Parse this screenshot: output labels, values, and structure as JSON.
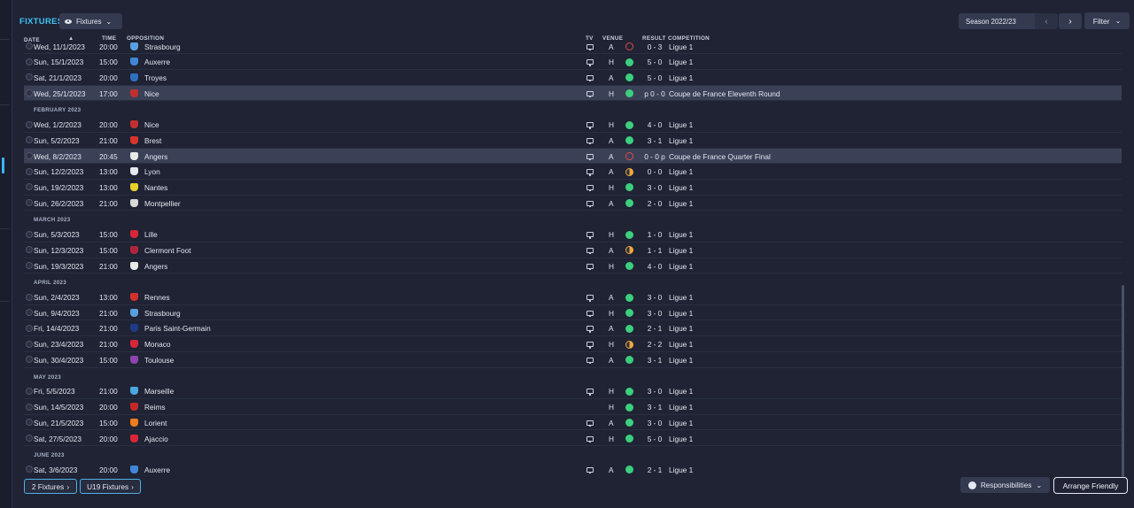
{
  "header": {
    "title": "FIXTURES",
    "view_dropdown": "Fixtures",
    "season": "Season 2022/23",
    "filter": "Filter"
  },
  "columns": {
    "date": "DATE",
    "time": "TIME",
    "opposition": "OPPOSITION",
    "tv": "TV",
    "venue": "VENUE",
    "result": "RESULT",
    "competition": "COMPETITION"
  },
  "rows": [
    {
      "kind": "match",
      "date": "Wed, 11/1/2023",
      "time": "20:00",
      "opp": "Strasbourg",
      "crest": "#5aa0e0",
      "tv": true,
      "venue": "A",
      "res": "L",
      "score": "0 - 3",
      "comp": "Ligue 1"
    },
    {
      "kind": "match",
      "date": "Sun, 15/1/2023",
      "time": "15:00",
      "opp": "Auxerre",
      "crest": "#3f86d8",
      "tv": true,
      "venue": "H",
      "res": "W",
      "score": "5 - 0",
      "comp": "Ligue 1"
    },
    {
      "kind": "match",
      "date": "Sat, 21/1/2023",
      "time": "20:00",
      "opp": "Troyes",
      "crest": "#2f6fc0",
      "tv": true,
      "venue": "A",
      "res": "W",
      "score": "5 - 0",
      "comp": "Ligue 1"
    },
    {
      "kind": "match",
      "date": "Wed, 25/1/2023",
      "time": "17:00",
      "opp": "Nice",
      "crest": "#c0302f",
      "tv": true,
      "venue": "H",
      "res": "W",
      "score": "p 0 - 0",
      "comp": "Coupe de France Eleventh Round",
      "hl": true
    },
    {
      "kind": "month",
      "label": "FEBRUARY 2023"
    },
    {
      "kind": "match",
      "date": "Wed, 1/2/2023",
      "time": "20:00",
      "opp": "Nice",
      "crest": "#c0302f",
      "tv": true,
      "venue": "H",
      "res": "W",
      "score": "4 - 0",
      "comp": "Ligue 1"
    },
    {
      "kind": "match",
      "date": "Sun, 5/2/2023",
      "time": "21:00",
      "opp": "Brest",
      "crest": "#d9342b",
      "tv": true,
      "venue": "A",
      "res": "W",
      "score": "3 - 1",
      "comp": "Ligue 1"
    },
    {
      "kind": "match",
      "date": "Wed, 8/2/2023",
      "time": "20:45",
      "opp": "Angers",
      "crest": "#e9e9e9",
      "tv": true,
      "venue": "A",
      "res": "L",
      "score": "0 - 0 p",
      "comp": "Coupe de France Quarter Final",
      "hl": true
    },
    {
      "kind": "match",
      "date": "Sun, 12/2/2023",
      "time": "13:00",
      "opp": "Lyon",
      "crest": "#e8e8f0",
      "tv": true,
      "venue": "A",
      "res": "D",
      "score": "0 - 0",
      "comp": "Ligue 1"
    },
    {
      "kind": "match",
      "date": "Sun, 19/2/2023",
      "time": "13:00",
      "opp": "Nantes",
      "crest": "#e8d12a",
      "tv": true,
      "venue": "H",
      "res": "W",
      "score": "3 - 0",
      "comp": "Ligue 1"
    },
    {
      "kind": "match",
      "date": "Sun, 26/2/2023",
      "time": "21:00",
      "opp": "Montpellier",
      "crest": "#d8d8d8",
      "tv": true,
      "venue": "A",
      "res": "W",
      "score": "2 - 0",
      "comp": "Ligue 1"
    },
    {
      "kind": "month",
      "label": "MARCH 2023"
    },
    {
      "kind": "match",
      "date": "Sun, 5/3/2023",
      "time": "15:00",
      "opp": "Lille",
      "crest": "#d8263a",
      "tv": true,
      "venue": "H",
      "res": "W",
      "score": "1 - 0",
      "comp": "Ligue 1"
    },
    {
      "kind": "match",
      "date": "Sun, 12/3/2023",
      "time": "15:00",
      "opp": "Clermont Foot",
      "crest": "#b0253a",
      "tv": true,
      "venue": "A",
      "res": "D",
      "score": "1 - 1",
      "comp": "Ligue 1"
    },
    {
      "kind": "match",
      "date": "Sun, 19/3/2023",
      "time": "21:00",
      "opp": "Angers",
      "crest": "#e9e9e9",
      "tv": true,
      "venue": "H",
      "res": "W",
      "score": "4 - 0",
      "comp": "Ligue 1"
    },
    {
      "kind": "month",
      "label": "APRIL 2023"
    },
    {
      "kind": "match",
      "date": "Sun, 2/4/2023",
      "time": "13:00",
      "opp": "Rennes",
      "crest": "#d32f2f",
      "tv": true,
      "venue": "A",
      "res": "W",
      "score": "3 - 0",
      "comp": "Ligue 1"
    },
    {
      "kind": "match",
      "date": "Sun, 9/4/2023",
      "time": "21:00",
      "opp": "Strasbourg",
      "crest": "#5aa0e0",
      "tv": true,
      "venue": "H",
      "res": "W",
      "score": "3 - 0",
      "comp": "Ligue 1"
    },
    {
      "kind": "match",
      "date": "Fri, 14/4/2023",
      "time": "21:00",
      "opp": "Paris Saint-Germain",
      "crest": "#1f3c88",
      "tv": true,
      "venue": "A",
      "res": "W",
      "score": "2 - 1",
      "comp": "Ligue 1"
    },
    {
      "kind": "match",
      "date": "Sun, 23/4/2023",
      "time": "21:00",
      "opp": "Monaco",
      "crest": "#d8263a",
      "tv": true,
      "venue": "H",
      "res": "D",
      "score": "2 - 2",
      "comp": "Ligue 1"
    },
    {
      "kind": "match",
      "date": "Sun, 30/4/2023",
      "time": "15:00",
      "opp": "Toulouse",
      "crest": "#8e44ad",
      "tv": true,
      "venue": "A",
      "res": "W",
      "score": "3 - 1",
      "comp": "Ligue 1"
    },
    {
      "kind": "month",
      "label": "MAY 2023"
    },
    {
      "kind": "match",
      "date": "Fri, 5/5/2023",
      "time": "21:00",
      "opp": "Marseille",
      "crest": "#4aa8e0",
      "tv": true,
      "venue": "H",
      "res": "W",
      "score": "3 - 0",
      "comp": "Ligue 1"
    },
    {
      "kind": "match",
      "date": "Sun, 14/5/2023",
      "time": "20:00",
      "opp": "Reims",
      "crest": "#c62828",
      "tv": false,
      "venue": "H",
      "res": "W",
      "score": "3 - 1",
      "comp": "Ligue 1"
    },
    {
      "kind": "match",
      "date": "Sun, 21/5/2023",
      "time": "15:00",
      "opp": "Lorient",
      "crest": "#f07c1e",
      "tv": true,
      "venue": "A",
      "res": "W",
      "score": "3 - 0",
      "comp": "Ligue 1"
    },
    {
      "kind": "match",
      "date": "Sat, 27/5/2023",
      "time": "20:00",
      "opp": "Ajaccio",
      "crest": "#d8263a",
      "tv": true,
      "venue": "H",
      "res": "W",
      "score": "5 - 0",
      "comp": "Ligue 1"
    },
    {
      "kind": "month",
      "label": "JUNE 2023"
    },
    {
      "kind": "match",
      "date": "Sat, 3/6/2023",
      "time": "20:00",
      "opp": "Auxerre",
      "crest": "#3f86d8",
      "tv": true,
      "venue": "A",
      "res": "W",
      "score": "2 - 1",
      "comp": "Ligue 1"
    }
  ],
  "footer": {
    "fixtures_2": "2 Fixtures",
    "u19_fixtures": "U19 Fixtures",
    "responsibilities": "Responsibilities",
    "arrange_friendly": "Arrange Friendly"
  },
  "colors": {
    "accent": "#3fc3f5",
    "win": "#3ccf7d",
    "draw": "#f2a93b",
    "loss": "#e34a4a"
  }
}
